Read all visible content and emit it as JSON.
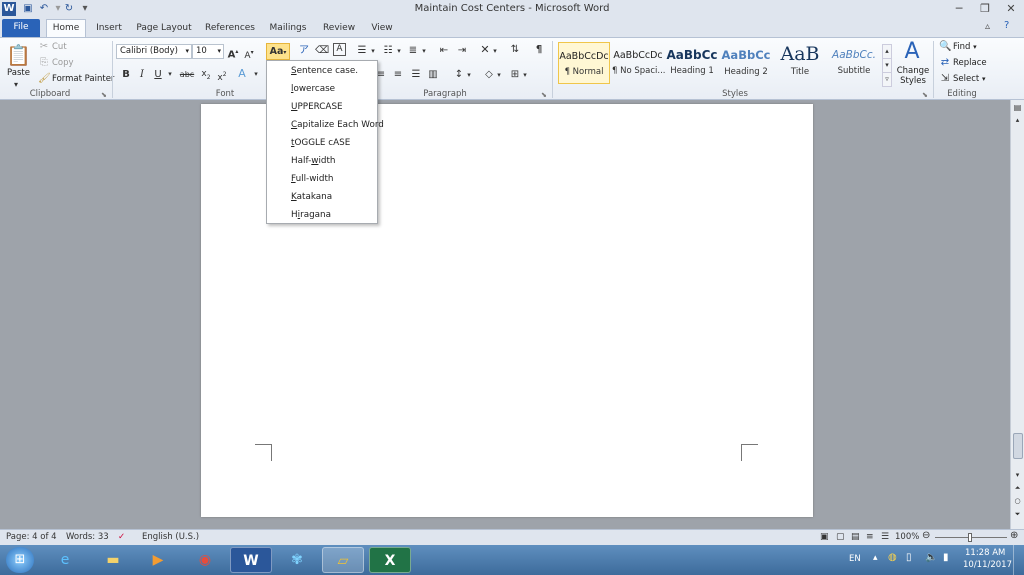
{
  "window": {
    "title": "Maintain Cost Centers - Microsoft Word"
  },
  "tabs": [
    "File",
    "Home",
    "Insert",
    "Page Layout",
    "References",
    "Mailings",
    "Review",
    "View"
  ],
  "clipboard": {
    "paste": "Paste",
    "cut": "Cut",
    "copy": "Copy",
    "format_painter": "Format Painter",
    "group": "Clipboard"
  },
  "font": {
    "family": "Calibri (Body)",
    "size": "10",
    "change_case": "Aa",
    "group": "Font"
  },
  "paragraph": {
    "group": "Paragraph"
  },
  "styles": {
    "items": [
      {
        "preview": "AaBbCcDc",
        "name": "¶ Normal"
      },
      {
        "preview": "AaBbCcDc",
        "name": "¶ No Spaci..."
      },
      {
        "preview": "AaBbCc",
        "name": "Heading 1"
      },
      {
        "preview": "AaBbCc",
        "name": "Heading 2"
      },
      {
        "preview": "AaB",
        "name": "Title"
      },
      {
        "preview": "AaBbCc.",
        "name": "Subtitle"
      }
    ],
    "change_styles": "Change Styles",
    "group": "Styles"
  },
  "editing": {
    "find": "Find",
    "replace": "Replace",
    "select": "Select",
    "group": "Editing"
  },
  "change_case_menu": [
    {
      "first": "S",
      "rest": "entence case."
    },
    {
      "first": "l",
      "rest": "owercase"
    },
    {
      "first": "U",
      "rest": "PPERCASE"
    },
    {
      "first": "C",
      "rest": "apitalize Each Word"
    },
    {
      "first": "t",
      "rest": "OGGLE cASE"
    },
    {
      "pre": "Half-",
      "first": "w",
      "rest": "idth"
    },
    {
      "first": "F",
      "rest": "ull-width"
    },
    {
      "first": "K",
      "rest": "atakana"
    },
    {
      "pre": "H",
      "first": "i",
      "rest": "ragana"
    }
  ],
  "status": {
    "page": "Page: 4 of 4",
    "words": "Words: 33",
    "language": "English (U.S.)",
    "zoom": "100%"
  },
  "tray": {
    "lang": "EN",
    "time": "11:28 AM",
    "date": "10/11/2017"
  }
}
